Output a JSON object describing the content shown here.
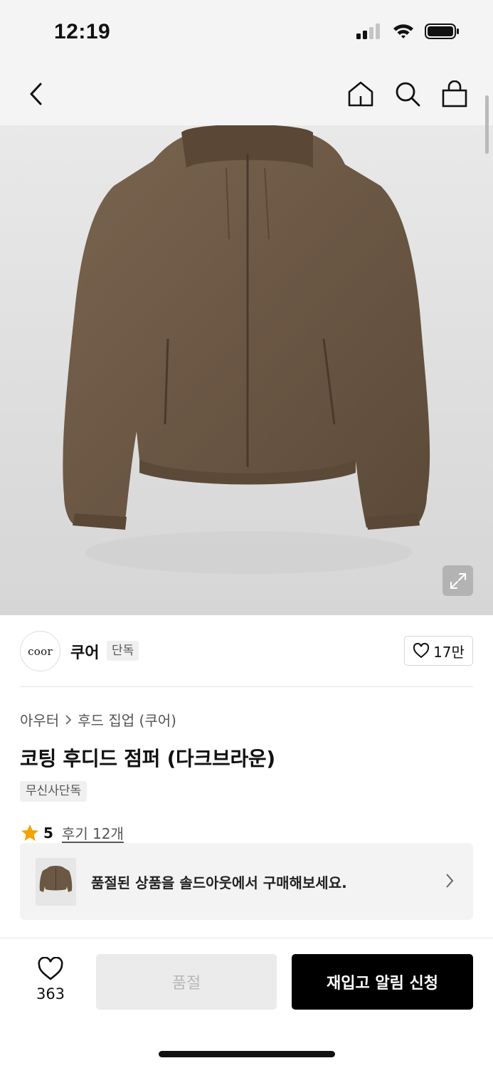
{
  "status_bar": {
    "time": "12:19"
  },
  "nav": {
    "back_icon": "chevron-left-icon",
    "home_icon": "home-icon",
    "search_icon": "search-icon",
    "cart_icon": "shopping-bag-icon"
  },
  "brand": {
    "logo_text": "coor",
    "name": "쿠어",
    "badge": "단독",
    "like_count": "17만"
  },
  "breadcrumb": {
    "category": "아우터",
    "subcategory": "후드 집업 (쿠어)"
  },
  "product": {
    "title": "코팅 후디드 점퍼 (다크브라운)",
    "tag": "무신사단독"
  },
  "rating": {
    "score": "5",
    "review_label": "후기 12개"
  },
  "soldout_card": {
    "text": "품절된 상품을 솔드아웃에서 구매해보세요."
  },
  "bottom_bar": {
    "wish_count": "363",
    "soldout_label": "품절",
    "restock_label": "재입고 알림 신청"
  },
  "colors": {
    "accent_star": "#f5a200",
    "jacket": "#6b5744",
    "primary_button": "#000000"
  }
}
